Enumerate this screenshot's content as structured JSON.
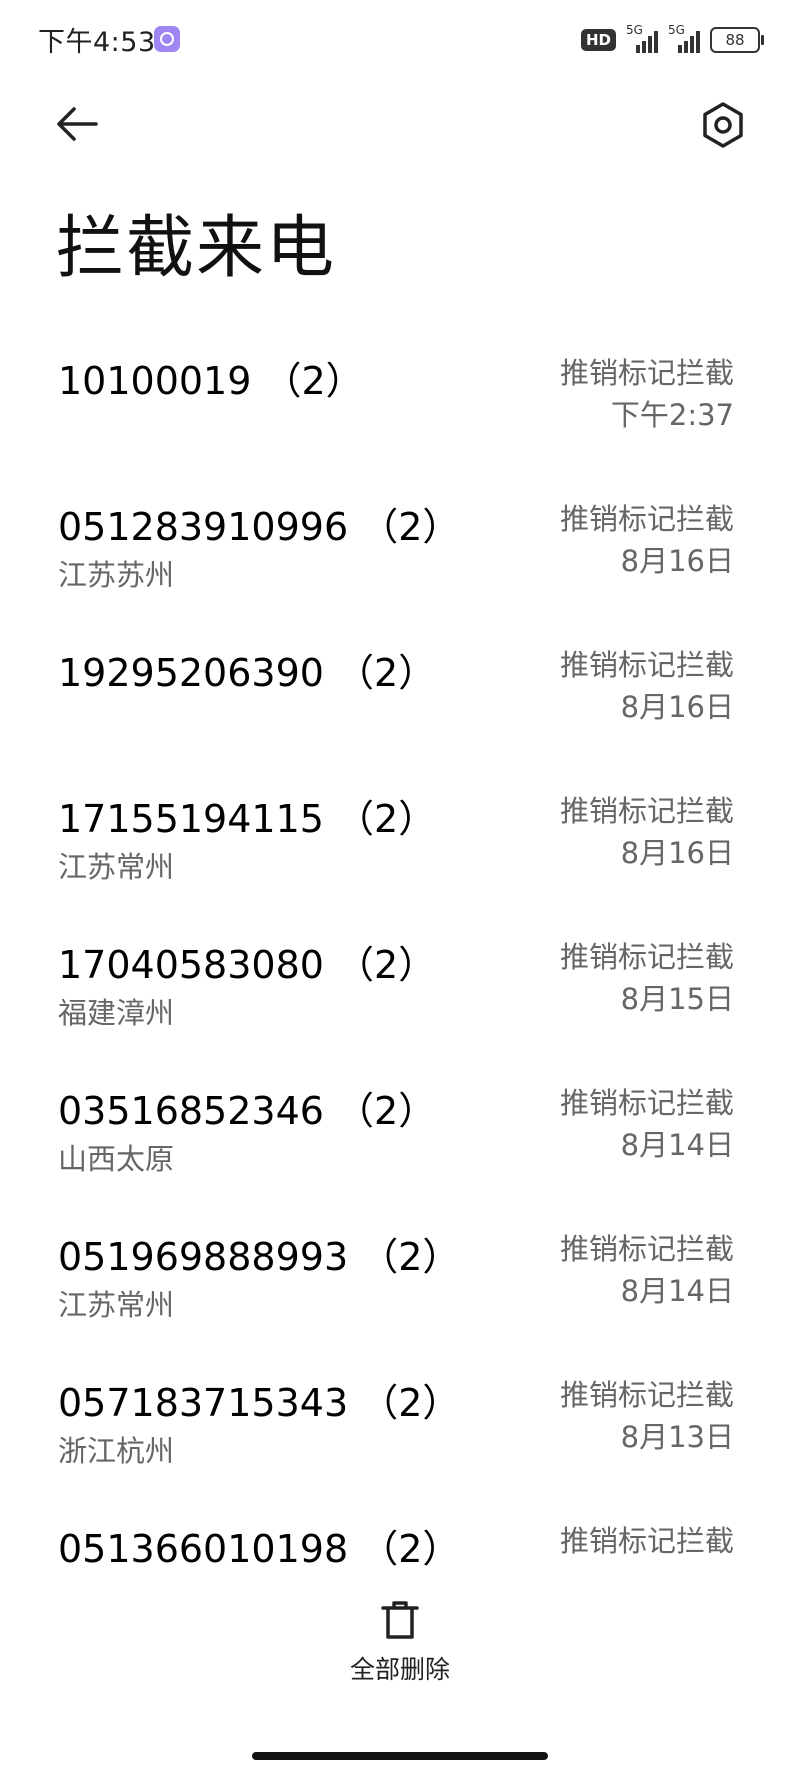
{
  "status_bar": {
    "time": "下午4:53",
    "hd_label": "HD",
    "sim1_label": "5G",
    "sim2_label": "5G",
    "battery": "88"
  },
  "header": {
    "back_icon": "arrow-left-icon",
    "settings_icon": "gear-icon",
    "title": "拦截来电"
  },
  "calls": [
    {
      "number": "10100019 （2）",
      "location": "",
      "reason": "推销标记拦截",
      "time": "下午2:37"
    },
    {
      "number": "051283910996 （2）",
      "location": "江苏苏州",
      "reason": "推销标记拦截",
      "time": "8月16日"
    },
    {
      "number": "19295206390 （2）",
      "location": "",
      "reason": "推销标记拦截",
      "time": "8月16日"
    },
    {
      "number": "17155194115 （2）",
      "location": "江苏常州",
      "reason": "推销标记拦截",
      "time": "8月16日"
    },
    {
      "number": "17040583080 （2）",
      "location": "福建漳州",
      "reason": "推销标记拦截",
      "time": "8月15日"
    },
    {
      "number": "03516852346 （2）",
      "location": "山西太原",
      "reason": "推销标记拦截",
      "time": "8月14日"
    },
    {
      "number": "051969888993 （2）",
      "location": "江苏常州",
      "reason": "推销标记拦截",
      "time": "8月14日"
    },
    {
      "number": "057183715343 （2）",
      "location": "浙江杭州",
      "reason": "推销标记拦截",
      "time": "8月13日"
    },
    {
      "number": "051366010198 （2）",
      "location": "",
      "reason": "推销标记拦截",
      "time": ""
    }
  ],
  "footer": {
    "delete_all_icon": "trash-icon",
    "delete_all_label": "全部删除"
  }
}
